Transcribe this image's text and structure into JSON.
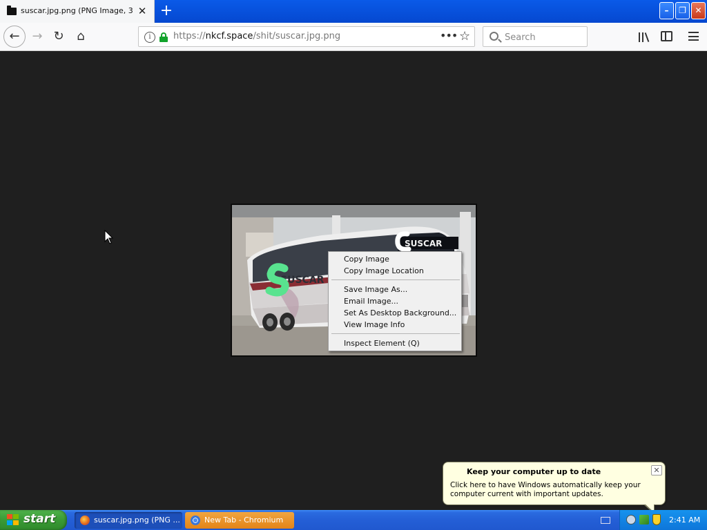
{
  "browser": {
    "tab_title": "suscar.jpg.png (PNG Image, 358",
    "url_prefix": "https://",
    "url_host": "nkcf.space",
    "url_path": "/shit/suscar.jpg.png",
    "search_placeholder": "Search"
  },
  "context_menu": {
    "items": [
      "Copy Image",
      "Copy Image Location",
      "Save Image As...",
      "Email Image...",
      "Set As Desktop Background...",
      "View Image Info",
      "Inspect Element (Q)"
    ]
  },
  "image": {
    "bus_brand": "SUSCAR"
  },
  "notification": {
    "title": "Keep your computer up to date",
    "text": "Click here to have Windows automatically keep your computer current with important updates."
  },
  "taskbar": {
    "start_label": "start",
    "tasks": [
      "suscar.jpg.png (PNG ...",
      "New Tab - Chromium"
    ],
    "clock": "2:41 AM"
  },
  "colors": {
    "content_bg": "#1f1f1f",
    "taskbar_blue": "#245fd6",
    "active_task": "#e38418",
    "lock_green": "#12a32c"
  }
}
